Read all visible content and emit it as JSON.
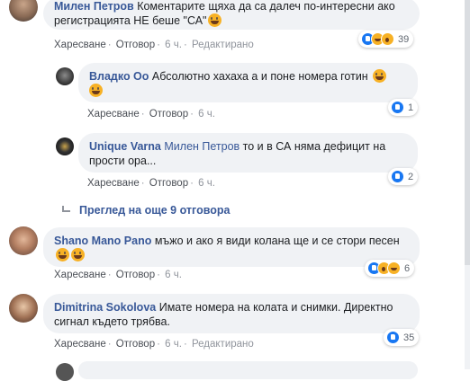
{
  "comments": [
    {
      "author": "Милен Петров",
      "text": "Коментарите щяха да са далеч по-интересни ако регистрацията НЕ беше \"СА\"",
      "like": "Харесване",
      "reply": "Отговор",
      "time": "6 ч.",
      "edited": "Редактирано",
      "reactions_count": "39"
    },
    {
      "author": "Владко Оо",
      "text": "Абсолютно хахаха а и поне номера готин",
      "like": "Харесване",
      "reply": "Отговор",
      "time": "6 ч.",
      "reactions_count": "1"
    },
    {
      "author": "Unique Varna",
      "tagged": "Милен Петров",
      "text": "то и в СА няма дефицит на прости ора...",
      "like": "Харесване",
      "reply": "Отговор",
      "time": "6 ч.",
      "reactions_count": "2"
    },
    {
      "author": "Shano Mano Pano",
      "text": "мъжо и ако я види колана ще и се стори песен",
      "like": "Харесване",
      "reply": "Отговор",
      "time": "6 ч.",
      "reactions_count": "6"
    },
    {
      "author": "Dimitrina Sokolova",
      "text": "Имате номера на колата и снимки. Директно сигнал където трябва.",
      "like": "Харесване",
      "reply": "Отговор",
      "time": "6 ч.",
      "edited": "Редактирано",
      "reactions_count": "35"
    }
  ],
  "view_more_replies": "Преглед на още 9 отговора",
  "separator": "·",
  "colors": {
    "link": "#385898",
    "bubble": "#f0f2f5",
    "like": "#1877f2",
    "haha": "#f7b125"
  }
}
